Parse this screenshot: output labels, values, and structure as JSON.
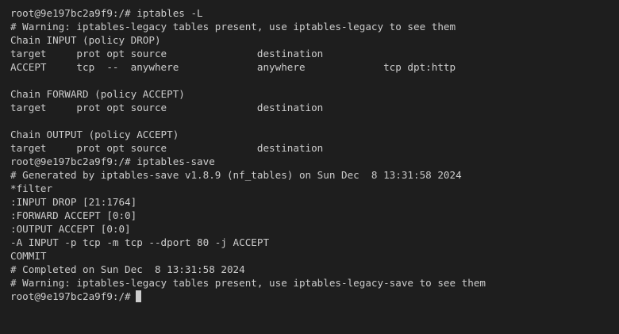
{
  "terminal": {
    "lines": [
      "root@9e197bc2a9f9:/# iptables -L",
      "# Warning: iptables-legacy tables present, use iptables-legacy to see them",
      "Chain INPUT (policy DROP)",
      "target     prot opt source               destination",
      "ACCEPT     tcp  --  anywhere             anywhere             tcp dpt:http",
      "",
      "Chain FORWARD (policy ACCEPT)",
      "target     prot opt source               destination",
      "",
      "Chain OUTPUT (policy ACCEPT)",
      "target     prot opt source               destination",
      "root@9e197bc2a9f9:/# iptables-save",
      "# Generated by iptables-save v1.8.9 (nf_tables) on Sun Dec  8 13:31:58 2024",
      "*filter",
      ":INPUT DROP [21:1764]",
      ":FORWARD ACCEPT [0:0]",
      ":OUTPUT ACCEPT [0:0]",
      "-A INPUT -p tcp -m tcp --dport 80 -j ACCEPT",
      "COMMIT",
      "# Completed on Sun Dec  8 13:31:58 2024",
      "# Warning: iptables-legacy tables present, use iptables-legacy-save to see them"
    ],
    "prompt": "root@9e197bc2a9f9:/#",
    "colors": {
      "background": "#1e1e1e",
      "foreground": "#cccccc"
    }
  }
}
